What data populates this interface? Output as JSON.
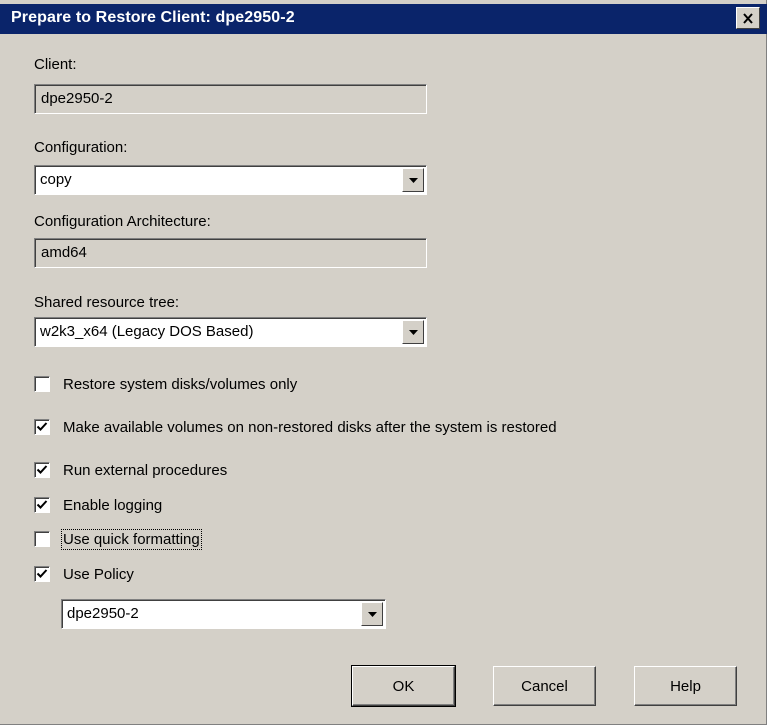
{
  "window": {
    "title": "Prepare to Restore Client: dpe2950-2"
  },
  "client": {
    "label": "Client:",
    "value": "dpe2950-2"
  },
  "configuration": {
    "label": "Configuration:",
    "value": "copy"
  },
  "architecture": {
    "label": "Configuration Architecture:",
    "value": "amd64"
  },
  "shared_tree": {
    "label": "Shared resource tree:",
    "value": "w2k3_x64 (Legacy DOS Based)"
  },
  "options": [
    {
      "label": "Restore system disks/volumes only",
      "checked": false
    },
    {
      "label": "Make available volumes on non-restored disks after the system is restored",
      "checked": true
    },
    {
      "label": "Run external procedures",
      "checked": true
    },
    {
      "label": "Enable logging",
      "checked": true
    },
    {
      "label": "Use quick formatting",
      "checked": false
    },
    {
      "label": "Use Policy",
      "checked": true
    }
  ],
  "policy": {
    "value": "dpe2950-2"
  },
  "buttons": {
    "ok": "OK",
    "cancel": "Cancel",
    "help": "Help"
  }
}
